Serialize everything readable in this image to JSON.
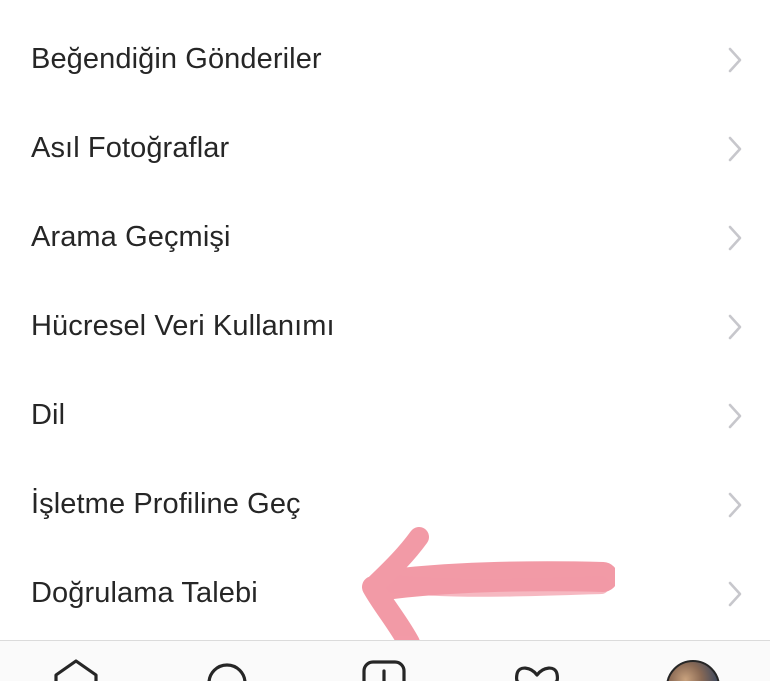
{
  "settings_menu": {
    "items": [
      {
        "label": "Beğendiğin Gönderiler",
        "icon": "chevron-right-icon"
      },
      {
        "label": "Asıl Fotoğraflar",
        "icon": "chevron-right-icon"
      },
      {
        "label": "Arama Geçmişi",
        "icon": "chevron-right-icon"
      },
      {
        "label": "Hücresel Veri Kullanımı",
        "icon": "chevron-right-icon"
      },
      {
        "label": "Dil",
        "icon": "chevron-right-icon"
      },
      {
        "label": "İşletme Profiline Geç",
        "icon": "chevron-right-icon"
      },
      {
        "label": "Doğrulama Talebi",
        "icon": "chevron-right-icon"
      }
    ]
  },
  "annotation": {
    "type": "hand-drawn-arrow",
    "color": "#ef7e8e",
    "points_to": "Doğrulama Talebi"
  },
  "tab_bar": {
    "tabs": [
      {
        "icon": "home-icon"
      },
      {
        "icon": "search-icon"
      },
      {
        "icon": "add-post-icon"
      },
      {
        "icon": "heart-icon"
      },
      {
        "icon": "profile-avatar"
      }
    ]
  },
  "colors": {
    "text": "#262626",
    "chevron": "#c7c7cc",
    "tab_bar_border": "#dbdbdb",
    "tab_bar_bg": "#fafafa",
    "arrow": "#ef7e8e"
  }
}
